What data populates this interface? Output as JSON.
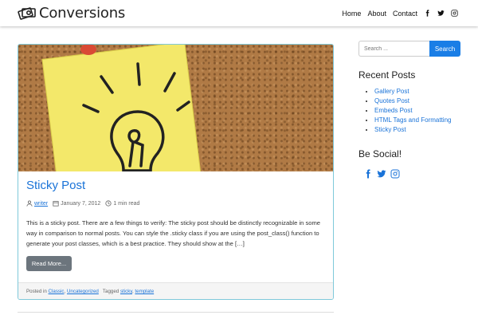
{
  "site": {
    "name": "Conversions",
    "logo_icon": "money-icon"
  },
  "nav": {
    "links": [
      "Home",
      "About",
      "Contact"
    ],
    "social_icons": [
      "facebook-icon",
      "twitter-icon",
      "instagram-icon"
    ]
  },
  "post": {
    "title": "Sticky Post",
    "author": "writer",
    "date": "January 7, 2012",
    "read_time": "1 min read",
    "excerpt": "This is a sticky post. There are a few things to verify: The sticky post should be distinctly recognizable in some way in comparison to normal posts. You can style the .sticky class if you are using the post_class() function to generate your post classes, which is a best practice. They should show at the […]",
    "read_more_label": "Read More...",
    "footer": {
      "posted_in_label": "Posted in",
      "categories": [
        "Classic",
        "Uncategorized"
      ],
      "tagged_label": "Tagged",
      "tags": [
        "sticky",
        "template"
      ]
    }
  },
  "sidebar": {
    "search_placeholder": "Search ...",
    "search_button": "Search",
    "recent_title": "Recent Posts",
    "recent_posts": [
      "Gallery Post",
      "Quotes Post",
      "Embeds Post",
      "HTML Tags and Formatting",
      "Sticky Post"
    ],
    "social_title": "Be Social!"
  },
  "colors": {
    "link": "#1a73d8",
    "accent": "#1a7ee6",
    "card_border": "#7fc9da",
    "button": "#6c757d"
  }
}
